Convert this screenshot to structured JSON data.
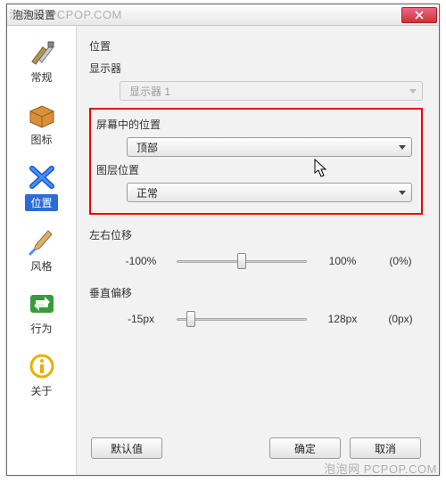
{
  "watermark": "泡泡网 PCPOP.COM",
  "window": {
    "title": "泡泡设置"
  },
  "sidebar": {
    "items": [
      {
        "label": "常规",
        "icon": "tools"
      },
      {
        "label": "图标",
        "icon": "box"
      },
      {
        "label": "位置",
        "icon": "position",
        "selected": true
      },
      {
        "label": "风格",
        "icon": "brush"
      },
      {
        "label": "行为",
        "icon": "arrows"
      },
      {
        "label": "关于",
        "icon": "info"
      }
    ]
  },
  "main": {
    "section_position": "位置",
    "monitor_label": "显示器",
    "monitor_value": "显示器 1",
    "screen_pos_label": "屏幕中的位置",
    "screen_pos_value": "顶部",
    "layer_label": "图层位置",
    "layer_value": "正常",
    "hshift_label": "左右位移",
    "hshift_min": "-100%",
    "hshift_max": "100%",
    "hshift_val": "(0%)",
    "hshift_pct": 50,
    "vshift_label": "垂直偏移",
    "vshift_min": "-15px",
    "vshift_max": "128px",
    "vshift_val": "(0px)",
    "vshift_pct": 11
  },
  "footer": {
    "defaults": "默认值",
    "ok": "确定",
    "cancel": "取消"
  }
}
